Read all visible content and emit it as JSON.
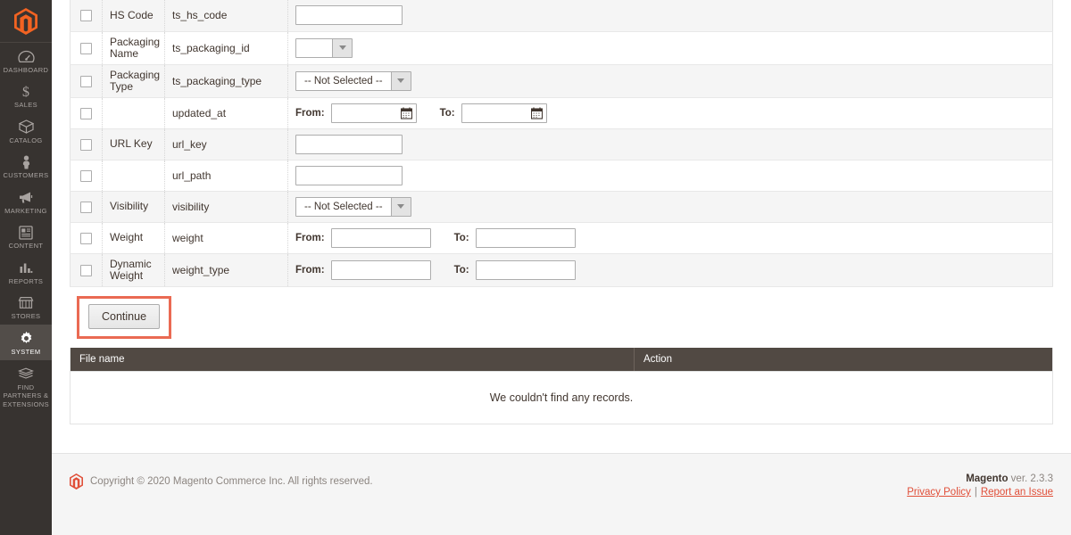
{
  "sidebar": {
    "logo_name": "magento-logo",
    "items": [
      {
        "label": "DASHBOARD",
        "icon": "dashboard-icon",
        "active": false
      },
      {
        "label": "SALES",
        "icon": "sales-dollar-icon",
        "active": false
      },
      {
        "label": "CATALOG",
        "icon": "catalog-box-icon",
        "active": false
      },
      {
        "label": "CUSTOMERS",
        "icon": "customers-person-icon",
        "active": false
      },
      {
        "label": "MARKETING",
        "icon": "marketing-megaphone-icon",
        "active": false
      },
      {
        "label": "CONTENT",
        "icon": "content-page-icon",
        "active": false
      },
      {
        "label": "REPORTS",
        "icon": "reports-bar-chart-icon",
        "active": false
      },
      {
        "label": "STORES",
        "icon": "stores-shop-icon",
        "active": false
      },
      {
        "label": "SYSTEM",
        "icon": "system-gear-icon",
        "active": true
      },
      {
        "label": "FIND PARTNERS & EXTENSIONS",
        "icon": "partners-box-icon",
        "active": false
      }
    ]
  },
  "attributes": {
    "rows": [
      {
        "label": "HS Code",
        "code": "ts_hs_code",
        "control": "text"
      },
      {
        "label": "Packaging Name",
        "code": "ts_packaging_id",
        "control": "select-narrow",
        "selected": ""
      },
      {
        "label": "Packaging Type",
        "code": "ts_packaging_type",
        "control": "select",
        "selected": "-- Not Selected --"
      },
      {
        "label": "",
        "code": "updated_at",
        "control": "date-range",
        "from_label": "From:",
        "to_label": "To:"
      },
      {
        "label": "URL Key",
        "code": "url_key",
        "control": "text"
      },
      {
        "label": "",
        "code": "url_path",
        "control": "text"
      },
      {
        "label": "Visibility",
        "code": "visibility",
        "control": "select",
        "selected": "-- Not Selected --"
      },
      {
        "label": "Weight",
        "code": "weight",
        "control": "num-range",
        "from_label": "From:",
        "to_label": "To:"
      },
      {
        "label": "Dynamic Weight",
        "code": "weight_type",
        "control": "num-range",
        "from_label": "From:",
        "to_label": "To:"
      }
    ]
  },
  "actions": {
    "continue_label": "Continue"
  },
  "file_grid": {
    "columns": [
      "File name",
      "Action"
    ],
    "empty_message": "We couldn't find any records."
  },
  "footer": {
    "copyright": "Copyright © 2020 Magento Commerce Inc. All rights reserved.",
    "brand": "Magento",
    "version": " ver. 2.3.3",
    "privacy_link": "Privacy Policy",
    "separator": "|",
    "report_link": "Report an Issue"
  },
  "colors": {
    "sidebar_bg": "#373330",
    "sidebar_active": "#524d49",
    "grid_header": "#514943",
    "accent_red": "#e04f39",
    "highlight_box": "#ea6a53",
    "row_stripe": "#f5f5f5"
  }
}
